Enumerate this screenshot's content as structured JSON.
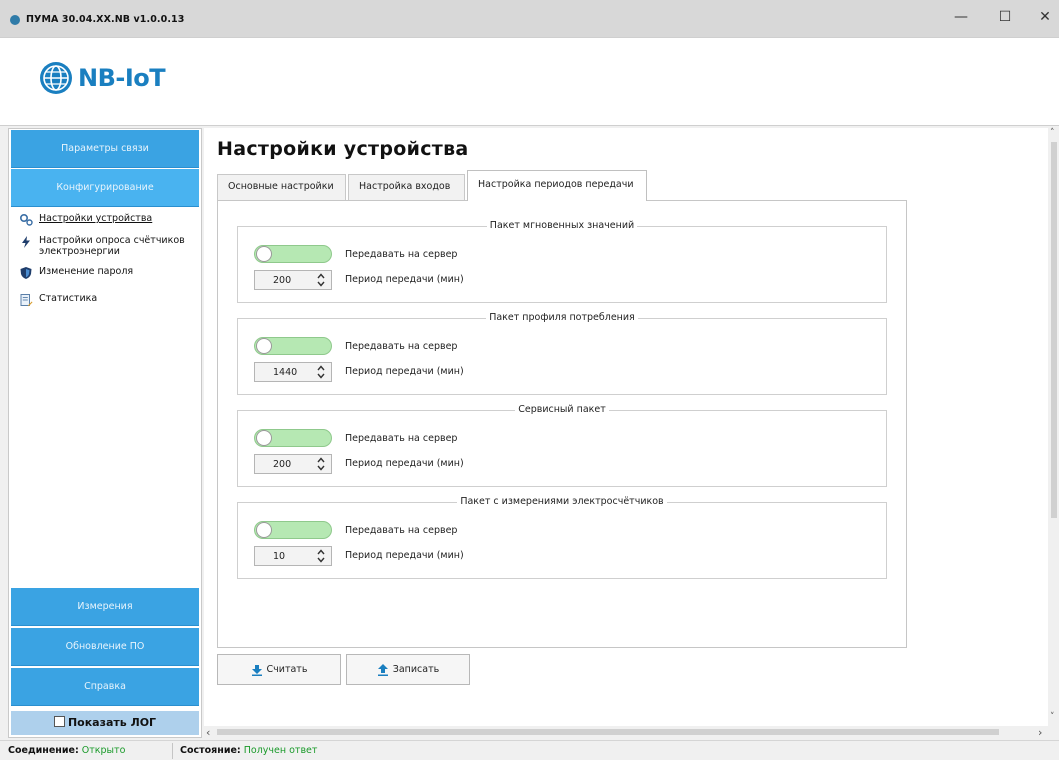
{
  "window": {
    "title": "ПУМА 30.04.XX.NB v1.0.0.13",
    "minimize": "—",
    "maximize": "☐",
    "close": "✕"
  },
  "logo": {
    "text": "NB-IoT"
  },
  "sidebar": {
    "nav_top": [
      {
        "label": "Параметры связи",
        "active": false
      },
      {
        "label": "Конфигурирование",
        "active": true
      }
    ],
    "sub_items": [
      {
        "label": "Настройки устройства",
        "icon": "gears-icon",
        "selected": true
      },
      {
        "label": "Настройки опроса счётчиков электроэнергии",
        "icon": "lightning-icon",
        "selected": false
      },
      {
        "label": "Изменение пароля",
        "icon": "shield-icon",
        "selected": false
      },
      {
        "label": "Статистика",
        "icon": "report-icon",
        "selected": false
      }
    ],
    "nav_bottom": [
      {
        "label": "Измерения"
      },
      {
        "label": "Обновление ПО"
      },
      {
        "label": "Справка"
      }
    ],
    "show_log": {
      "label": "Показать ЛОГ",
      "checked": false
    }
  },
  "main": {
    "title": "Настройки устройства",
    "tabs": [
      {
        "label": "Основные настройки",
        "active": false
      },
      {
        "label": "Настройка входов",
        "active": false
      },
      {
        "label": "Настройка периодов передачи",
        "active": true
      }
    ],
    "groups": [
      {
        "title": "Пакет мгновенных значений",
        "toggle_label": "Передавать на сервер",
        "period_value": "200",
        "period_label": "Период передачи (мин)"
      },
      {
        "title": "Пакет профиля потребления",
        "toggle_label": "Передавать на сервер",
        "period_value": "1440",
        "period_label": "Период передачи (мин)"
      },
      {
        "title": "Сервисный пакет",
        "toggle_label": "Передавать на сервер",
        "period_value": "200",
        "period_label": "Период передачи (мин)"
      },
      {
        "title": "Пакет с измерениями электросчётчиков",
        "toggle_label": "Передавать на сервер",
        "period_value": "10",
        "period_label": "Период передачи (мин)"
      }
    ],
    "buttons": {
      "read": "Считать",
      "write": "Записать"
    }
  },
  "status": {
    "connection_label": "Соединение:",
    "connection_value": "Открыто",
    "state_label": "Состояние:",
    "state_value": "Получен ответ"
  },
  "colors": {
    "nav_blue": "#3aa3e3",
    "toggle_green": "#b6e8b3",
    "logo_blue": "#1a7fc0",
    "status_green": "#1a9a2a"
  }
}
